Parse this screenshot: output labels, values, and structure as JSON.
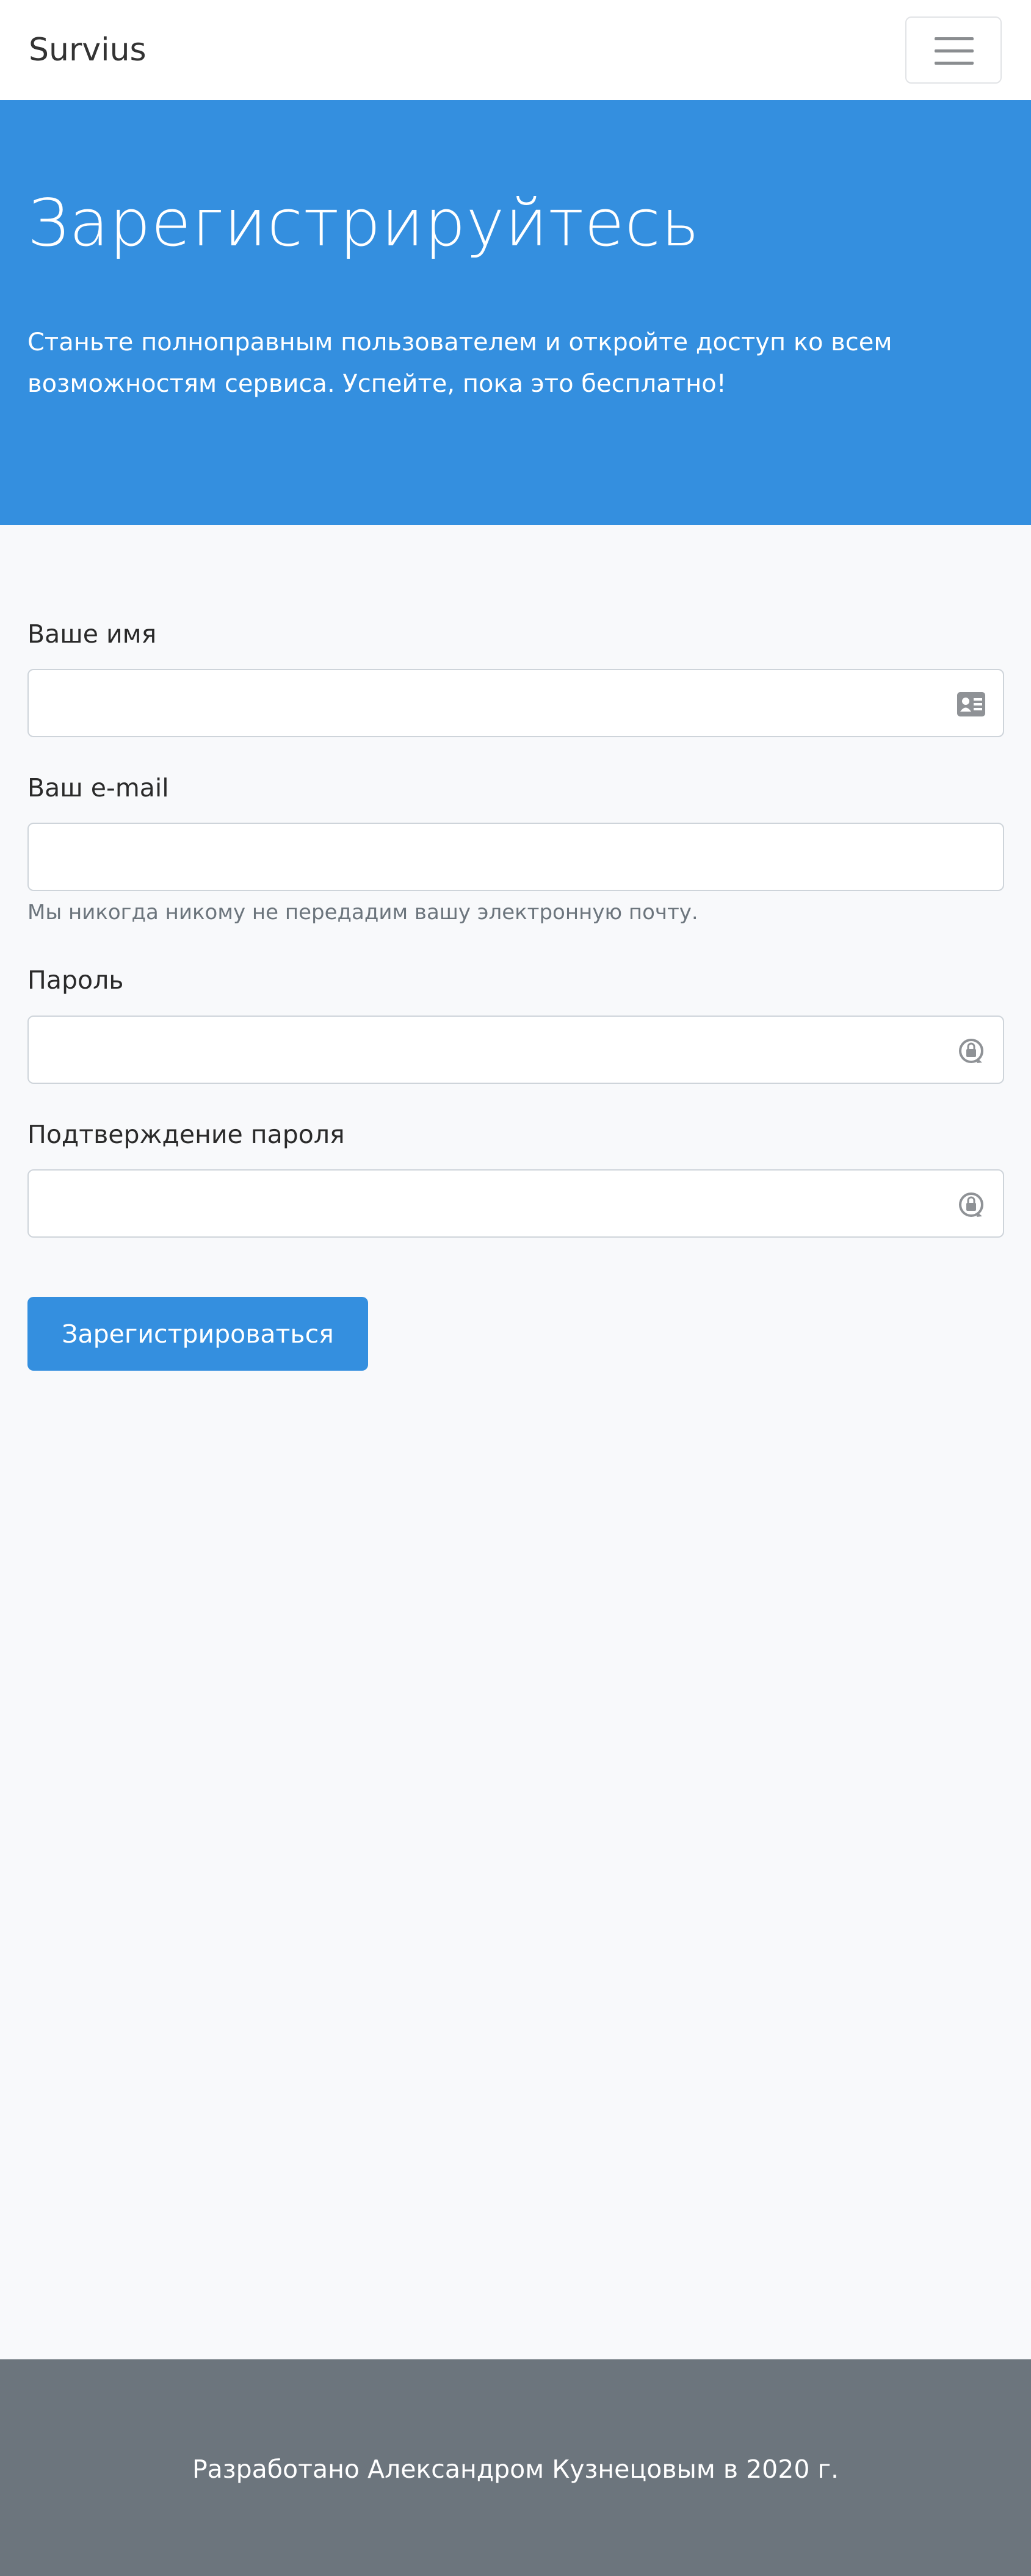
{
  "navbar": {
    "brand": "Survius",
    "toggle_icon": "hamburger-menu-icon"
  },
  "hero": {
    "title": "Зарегистрируйтесь",
    "subtitle": "Станьте полноправным пользователем и откройте доступ ко всем возможностям сервиса. Успейте, пока это бесплатно!"
  },
  "form": {
    "name": {
      "label": "Ваше имя",
      "value": "",
      "placeholder": "",
      "icon": "id-card-icon"
    },
    "email": {
      "label": "Ваш e-mail",
      "value": "",
      "placeholder": "",
      "help": "Мы никогда никому не передадим вашу электронную почту."
    },
    "password": {
      "label": "Пароль",
      "value": "",
      "placeholder": "",
      "icon": "password-lock-icon"
    },
    "password_confirm": {
      "label": "Подтверждение пароля",
      "value": "",
      "placeholder": "",
      "icon": "password-lock-icon"
    },
    "submit_label": "Зарегистрироваться"
  },
  "footer": {
    "text": "Разработано Александром Кузнецовым в 2020 г."
  },
  "colors": {
    "primary": "#348fdf",
    "footer": "#6c757d",
    "page_background": "#f8f9fb"
  }
}
